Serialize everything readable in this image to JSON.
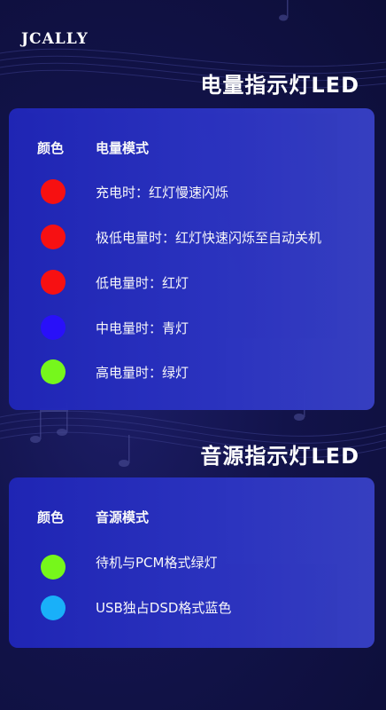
{
  "brand": {
    "logo_text": "JCALLY"
  },
  "battery_section": {
    "title": "电量指示灯LED",
    "col_color": "颜色",
    "col_mode": "电量模式",
    "rows": [
      {
        "label": "充电时：红灯慢速闪烁",
        "color": "#ff1010"
      },
      {
        "label": "极低电量时：红灯快速闪烁至自动关机",
        "color": "#ff1010"
      },
      {
        "label": "低电量时：红灯",
        "color": "#ff1010"
      },
      {
        "label": "中电量时：青灯",
        "color": "#2a10ff"
      },
      {
        "label": "高电量时：绿灯",
        "color": "#7aff1a"
      }
    ]
  },
  "source_section": {
    "title": "音源指示灯LED",
    "col_color": "颜色",
    "col_mode": "音源模式",
    "rows": [
      {
        "label": "待机与PCM格式绿灯",
        "color": "#7aff1a"
      },
      {
        "label": "USB独占DSD格式蓝色",
        "color": "#1ab6ff"
      }
    ]
  }
}
